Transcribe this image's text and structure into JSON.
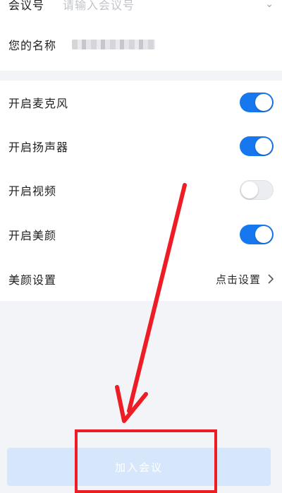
{
  "form": {
    "meeting_id": {
      "label": "会议号",
      "placeholder": "请输入会议号"
    },
    "name": {
      "label": "您的名称"
    }
  },
  "settings": [
    {
      "label": "开启麦克风",
      "on": true
    },
    {
      "label": "开启扬声器",
      "on": true
    },
    {
      "label": "开启视频",
      "on": false
    },
    {
      "label": "开启美颜",
      "on": true
    }
  ],
  "beauty": {
    "label": "美颜设置",
    "action": "点击设置"
  },
  "join_button": {
    "label": "加入会议"
  },
  "colors": {
    "accent": "#1677ee",
    "annotation": "#ee1c24",
    "button_disabled": "#d6e6fb"
  }
}
